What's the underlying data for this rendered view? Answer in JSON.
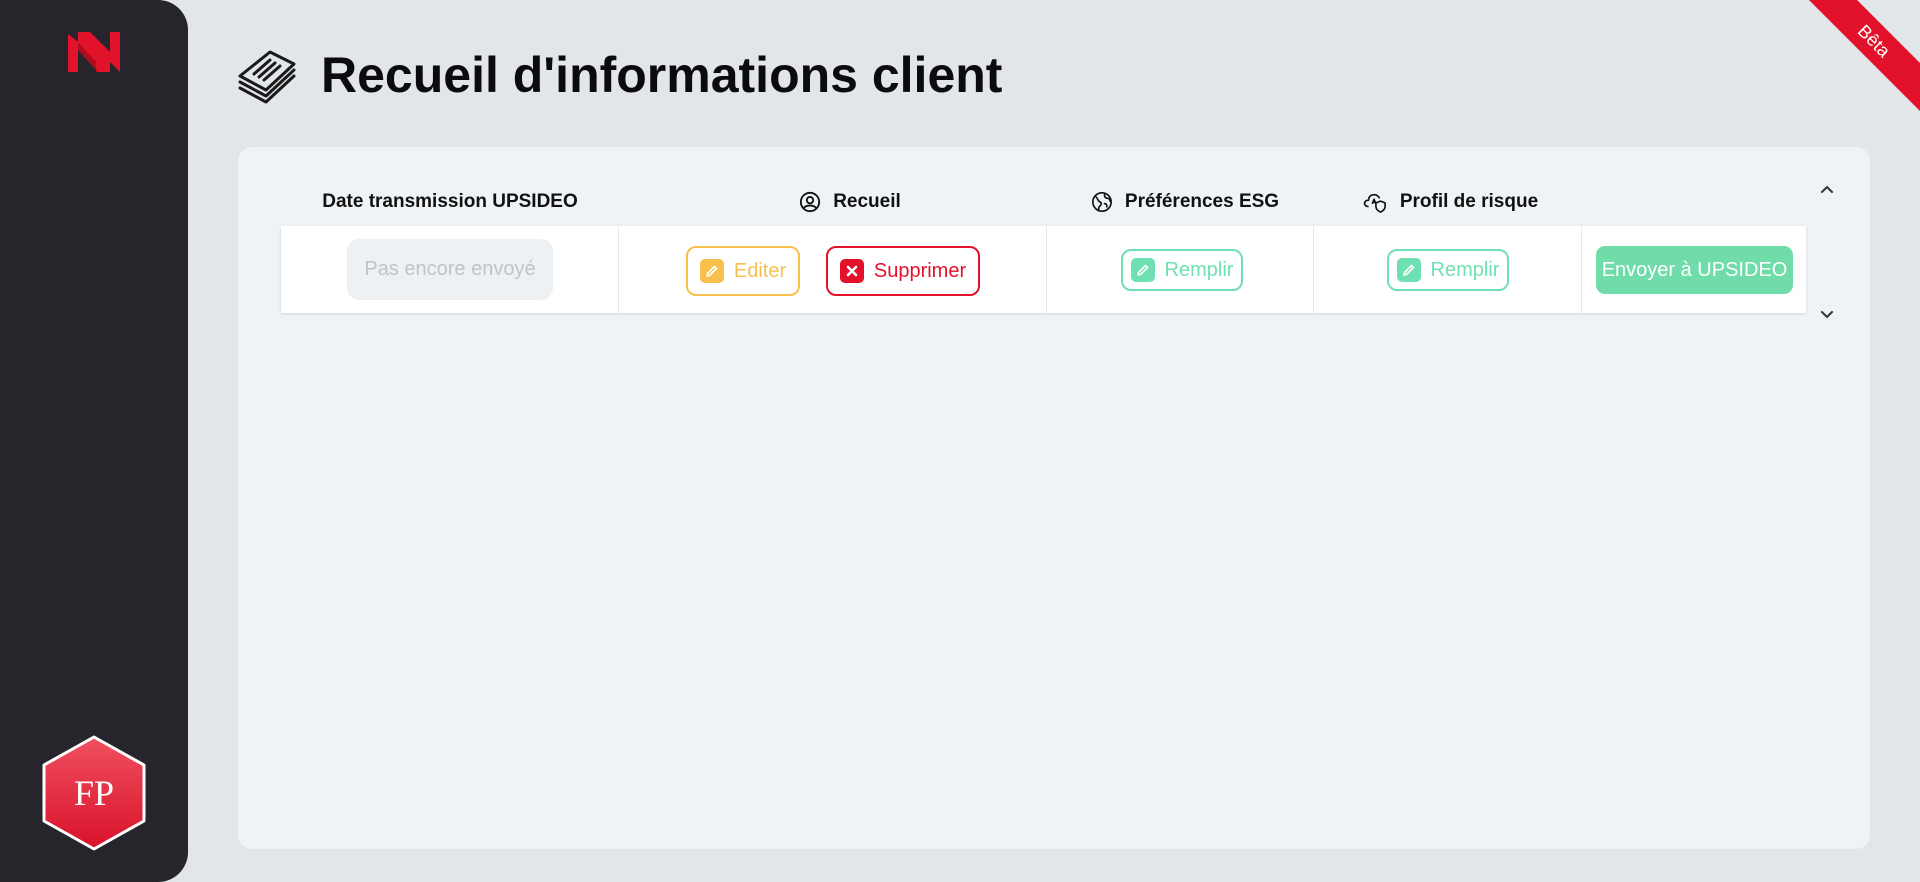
{
  "brand": {
    "accent": "#e3122b",
    "sidebar_bg": "#25252b",
    "success": "#6fdcaa",
    "warning": "#f7c04d"
  },
  "sidebar": {
    "logo_icon": "n-logo-icon",
    "avatar_initials": "FP"
  },
  "ribbon": {
    "label": "Bêta"
  },
  "header": {
    "title": "Recueil d'informations client",
    "icon": "stacked-documents-icon"
  },
  "table": {
    "headers": {
      "date": "Date transmission UPSIDEO",
      "recueil": "Recueil",
      "esg": "Préférences ESG",
      "risk": "Profil de risque"
    },
    "row": {
      "status": "Pas encore envoyé",
      "edit_label": "Editer",
      "delete_label": "Supprimer",
      "esg_fill_label": "Remplir",
      "risk_fill_label": "Remplir",
      "send_label": "Envoyer à UPSIDEO"
    }
  }
}
